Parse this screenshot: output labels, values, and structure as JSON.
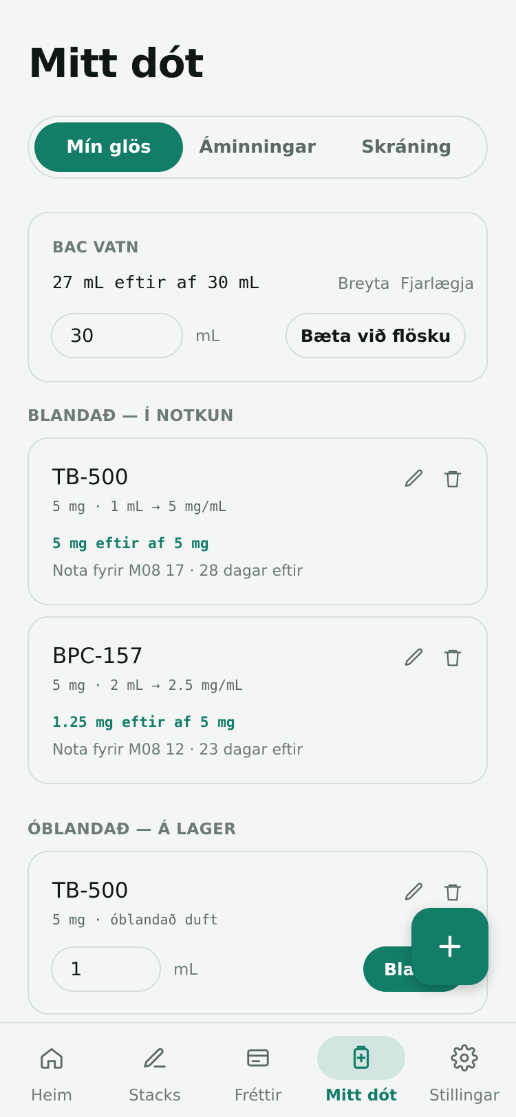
{
  "page": {
    "title": "Mitt dót"
  },
  "tabs": [
    {
      "label": "Mín glös",
      "active": true
    },
    {
      "label": "Áminningar",
      "active": false
    },
    {
      "label": "Skráning",
      "active": false
    }
  ],
  "bac": {
    "label": "BAC VATN",
    "remaining": "27 mL eftir af 30 mL",
    "edit_label": "Breyta",
    "remove_label": "Fjarlægja",
    "input_value": "30",
    "unit": "mL",
    "add_button_label": "Bæta við flösku"
  },
  "mixed_section": {
    "label": "BLANDAÐ — Í NOTKUN",
    "vials": [
      {
        "name": "TB-500",
        "spec": "5 mg · 1 mL → 5 mg/mL",
        "amount": "5 mg eftir af 5 mg",
        "note": "Nota fyrir M08 17 · 28 dagar eftir"
      },
      {
        "name": "BPC-157",
        "spec": "5 mg · 2 mL → 2.5 mg/mL",
        "amount": "1.25 mg eftir af 5 mg",
        "note": "Nota fyrir M08 12 · 23 dagar eftir"
      }
    ]
  },
  "unmixed_section": {
    "label": "ÓBLANDAÐ — Á LAGER",
    "vials": [
      {
        "name": "TB-500",
        "spec": "5 mg · óblandað duft",
        "input_value": "1",
        "unit": "mL",
        "mix_button_label": "Blanda"
      }
    ]
  },
  "nav": [
    {
      "label": "Heim",
      "icon": "home-icon",
      "active": false
    },
    {
      "label": "Stacks",
      "icon": "pencil-icon",
      "active": false
    },
    {
      "label": "Fréttir",
      "icon": "news-icon",
      "active": false
    },
    {
      "label": "Mitt dót",
      "icon": "vial-icon",
      "active": true
    },
    {
      "label": "Stillingar",
      "icon": "gear-icon",
      "active": false
    }
  ],
  "colors": {
    "accent": "#137d68",
    "background": "#f4f6f5",
    "border": "#d6dedb",
    "muted_text": "#6c7b75",
    "active_nav_bg": "#d2e5e0"
  }
}
